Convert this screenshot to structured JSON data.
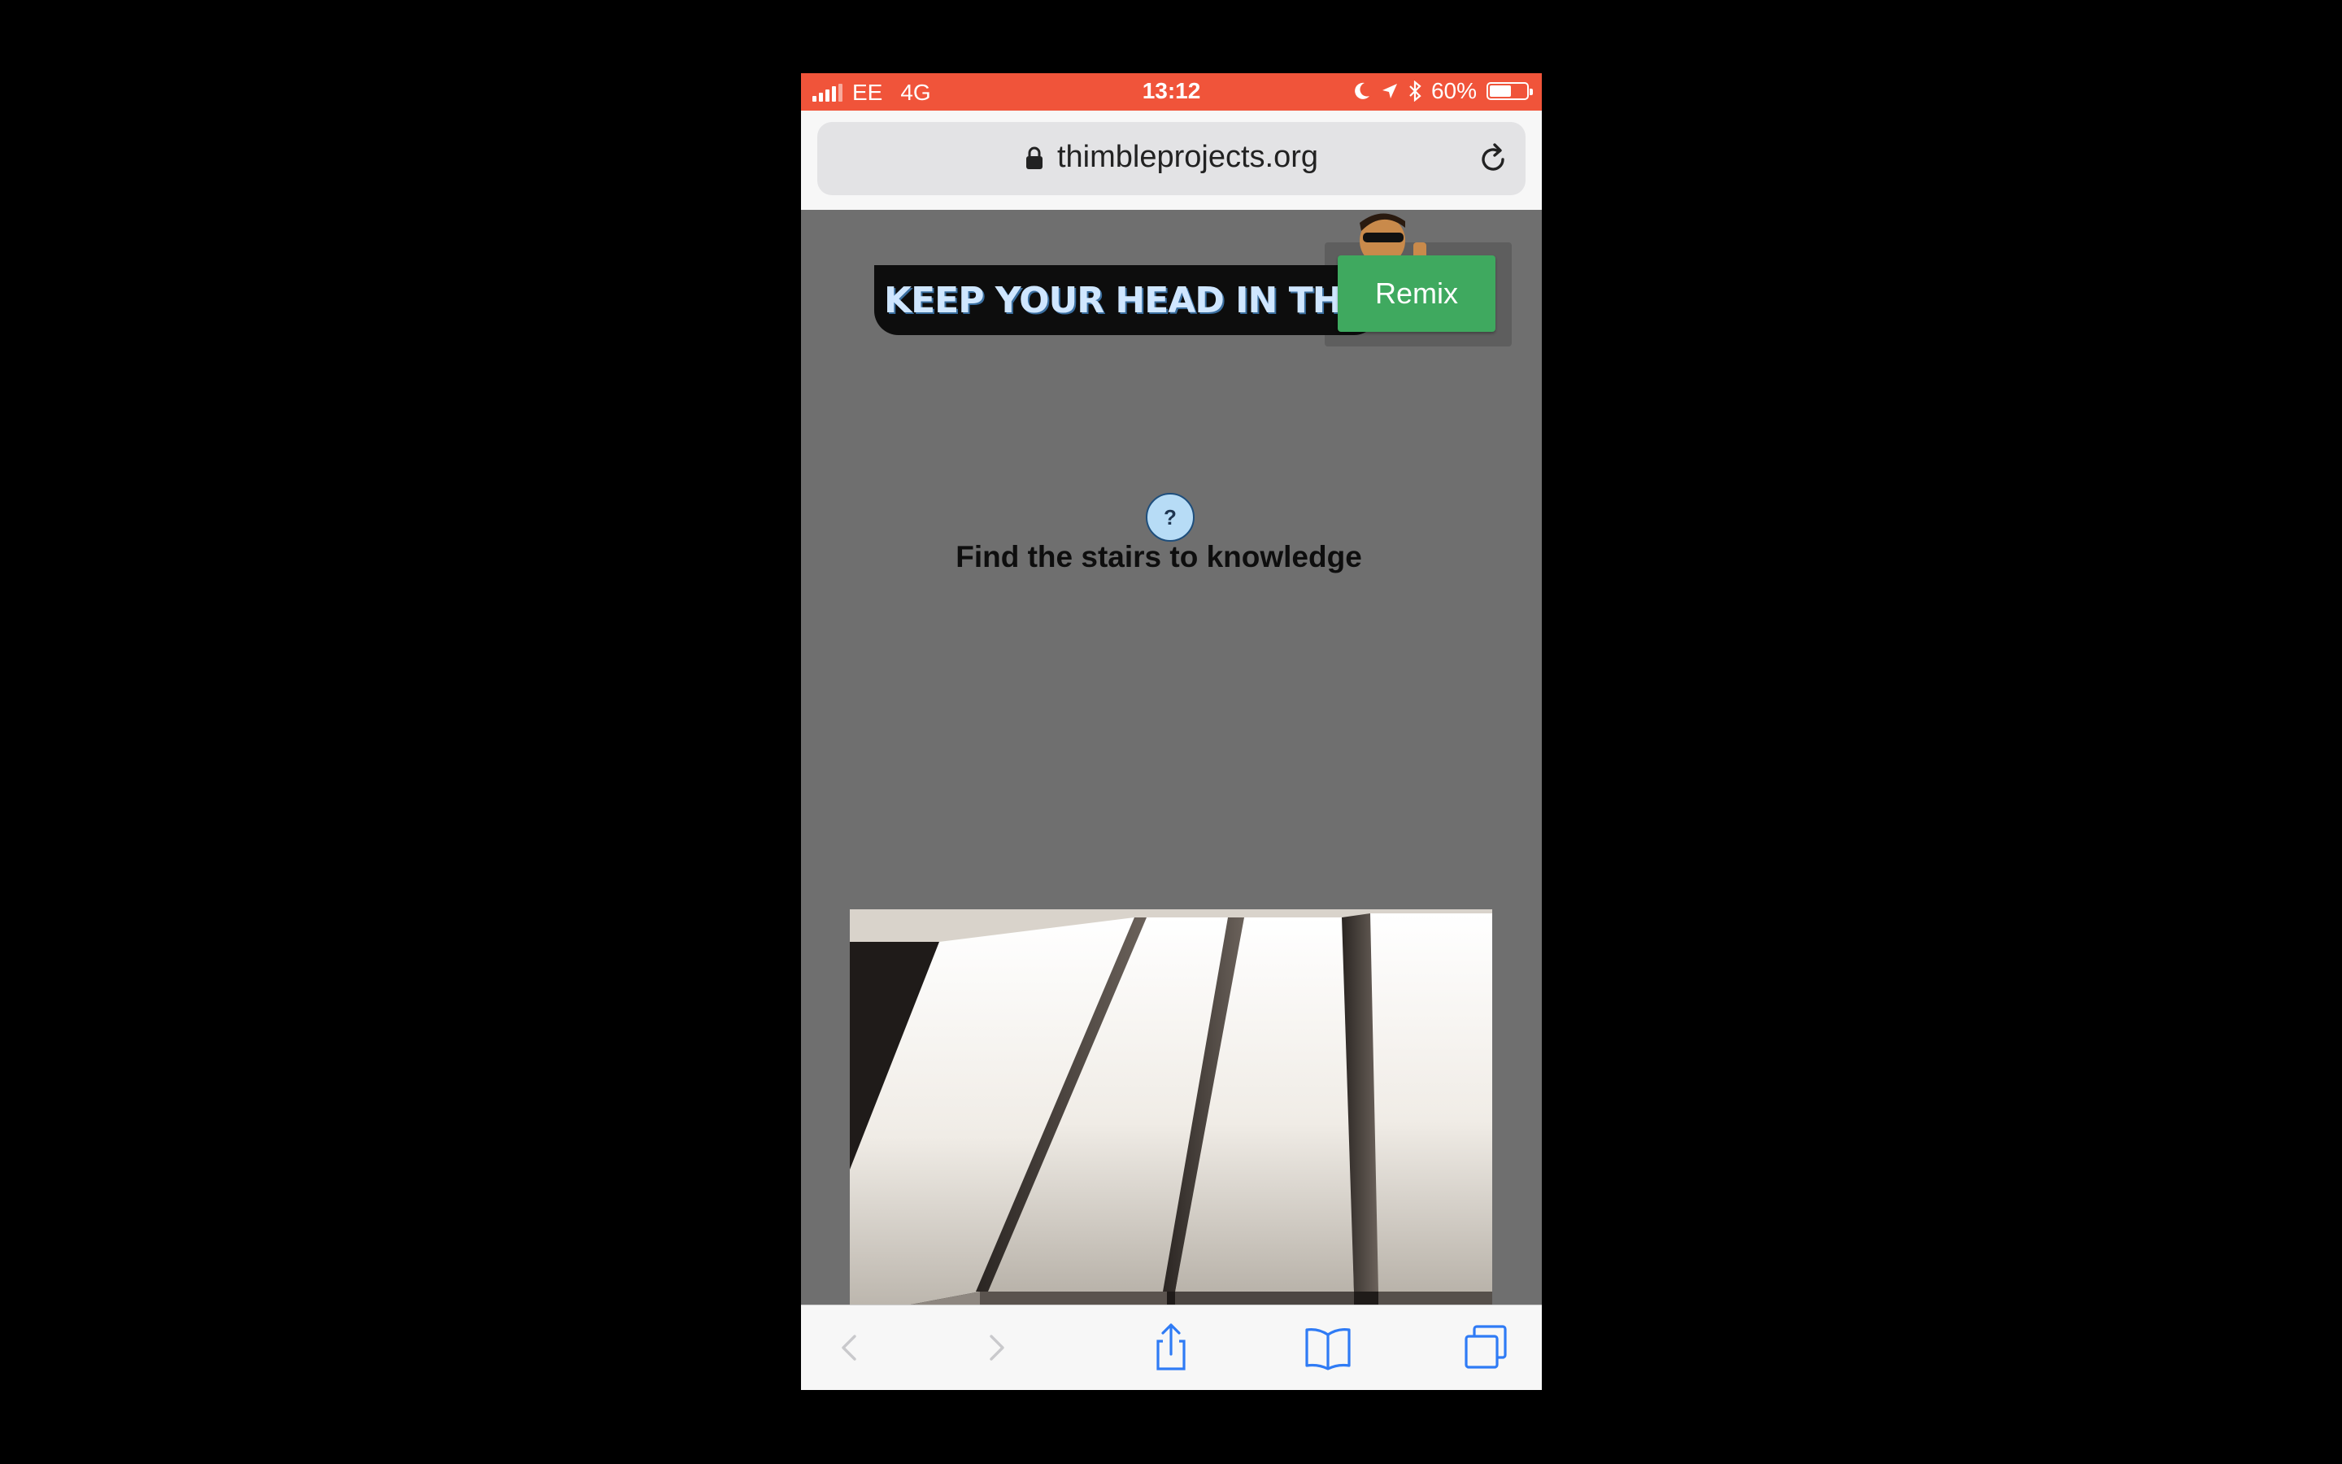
{
  "status_bar": {
    "carrier": "EE",
    "network": "4G",
    "time": "13:12",
    "battery": "60%",
    "battery_level": 0.6
  },
  "browser": {
    "url": "thimbleprojects.org"
  },
  "page": {
    "banner_text": "KEEP YOUR HEAD IN THE GA",
    "remix_label": "Remix",
    "help_label": "?",
    "hint_text": "Find the stairs to knowledge"
  },
  "toolbar": {
    "icons": [
      "back-icon",
      "forward-icon",
      "share-icon",
      "bookmarks-icon",
      "tabs-icon"
    ]
  },
  "colors": {
    "status_bar": "#f0543a",
    "page_background": "#6f6f6f",
    "remix_button": "#3fa95f",
    "ios_blue": "#2f7bf5"
  }
}
